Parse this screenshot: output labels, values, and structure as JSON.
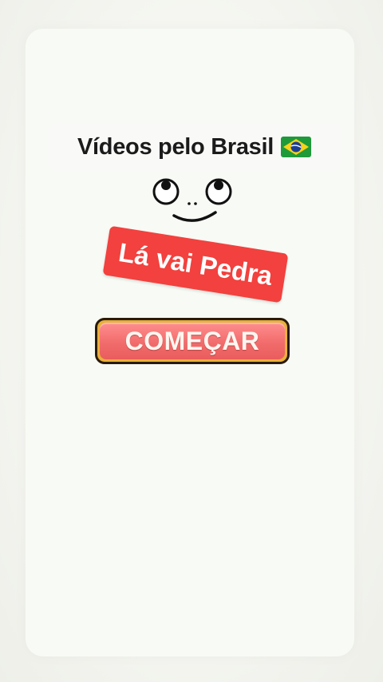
{
  "title": {
    "text": "Vídeos pelo Brasil",
    "flag_icon": "brazil-flag-icon"
  },
  "face": {
    "icon": "rolling-eyes-face-icon"
  },
  "sticker": {
    "text": "Lá vai Pedra",
    "color": "#f2413e"
  },
  "start_button": {
    "label": "COMEÇAR",
    "fill_color": "#f26c6c",
    "border_color": "#e8b13a"
  }
}
